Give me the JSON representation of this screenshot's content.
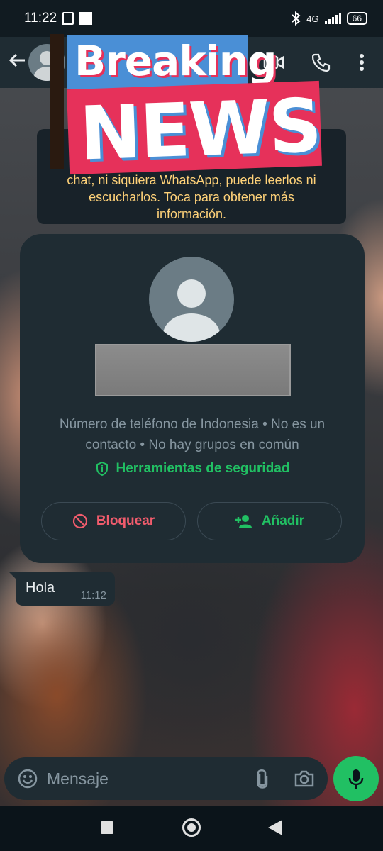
{
  "status_bar": {
    "time": "11:22",
    "network": "4G",
    "battery": "66"
  },
  "header": {
    "back_icon": "arrow-left-icon",
    "video_icon": "videocam-icon",
    "call_icon": "phone-icon",
    "menu_icon": "more-vert-icon"
  },
  "overlay": {
    "line1": "Breaking",
    "line2": "NEWS",
    "colors": {
      "blue": "#4a8fd6",
      "red": "#e6315a"
    }
  },
  "notice": {
    "text": "L... ...de este chat, ni siquiera WhatsApp, puede leerlos ni escucharlos. Toca para obtener más información.",
    "visible_text": "chat, ni siquiera WhatsApp, puede leerlos ni escucharlos. Toca para obtener más información."
  },
  "profile_card": {
    "contact_info": "Número de teléfono de Indonesia • No es un contacto • No hay grupos en común",
    "security_label": "Herramientas de seguridad",
    "block_label": "Bloquear",
    "add_label": "Añadir",
    "colors": {
      "green": "#21c063",
      "red": "#f15c6d"
    }
  },
  "messages": [
    {
      "text": "Hola",
      "time": "11:12"
    }
  ],
  "composer": {
    "placeholder": "Mensaje"
  }
}
